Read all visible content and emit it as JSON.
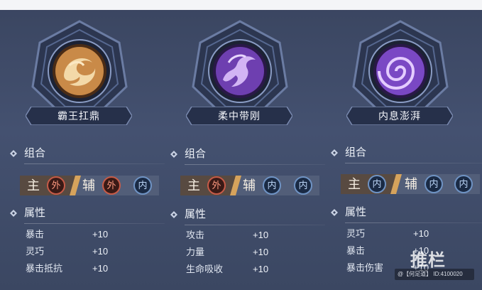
{
  "section_labels": {
    "combo": "组合",
    "attributes": "属性"
  },
  "role_labels": {
    "main": "主",
    "aux": "辅"
  },
  "cards": [
    {
      "name": "霸王扛鼎",
      "emblem_color": "#e0a15a",
      "main": [
        "外"
      ],
      "aux": [
        "外",
        "内"
      ],
      "attributes": [
        {
          "label": "暴击",
          "value": "+10"
        },
        {
          "label": "灵巧",
          "value": "+10"
        },
        {
          "label": "暴击抵抗",
          "value": "+10"
        }
      ]
    },
    {
      "name": "柔中带刚",
      "emblem_color": "#9d6ad8",
      "main": [
        "外"
      ],
      "aux": [
        "内",
        "内"
      ],
      "attributes": [
        {
          "label": "攻击",
          "value": "+10"
        },
        {
          "label": "力量",
          "value": "+10"
        },
        {
          "label": "生命吸收",
          "value": "+10"
        }
      ]
    },
    {
      "name": "内息澎湃",
      "emblem_color": "#a36be0",
      "main": [
        "内"
      ],
      "aux": [
        "内",
        "内"
      ],
      "attributes": [
        {
          "label": "灵巧",
          "value": "+10"
        },
        {
          "label": "暴击",
          "value": "+10"
        },
        {
          "label": "暴击伤害",
          "value": "+10"
        }
      ]
    }
  ],
  "watermark": {
    "logo": "推栏",
    "text": "@【何足道】 ID:4100020"
  }
}
